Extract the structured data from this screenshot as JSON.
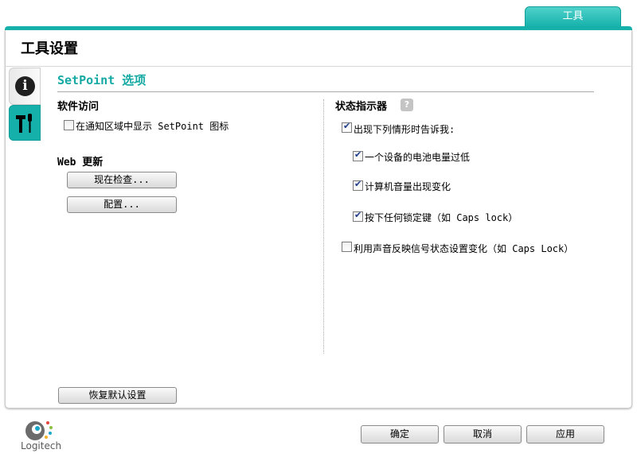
{
  "top_tab": {
    "label": "工具"
  },
  "panel": {
    "title": "工具设置"
  },
  "section": {
    "title": "SetPoint 选项"
  },
  "software_access": {
    "heading": "软件访问",
    "show_icon": {
      "label": "在通知区域中显示 SetPoint 图标",
      "checked": false
    }
  },
  "web_update": {
    "heading": "Web 更新",
    "check_now_label": "现在检查...",
    "configure_label": "配置..."
  },
  "status_indicator": {
    "heading": "状态指示器",
    "help_label": "?",
    "notify_me": {
      "label": "出现下列情形时告诉我:",
      "checked": true
    },
    "battery_low": {
      "label": "一个设备的电池电量过低",
      "checked": true
    },
    "volume_change": {
      "label": "计算机音量出现变化",
      "checked": true
    },
    "lock_key": {
      "label": "按下任何锁定键（如 Caps lock）",
      "checked": true
    },
    "sound_feedback": {
      "label": "利用声音反映信号状态设置变化（如 Caps Lock）",
      "checked": false
    }
  },
  "restore_defaults_label": "恢复默认设置",
  "footer": {
    "ok_label": "确定",
    "cancel_label": "取消",
    "apply_label": "应用",
    "logo_text": "Logitech"
  },
  "colors": {
    "accent": "#15b0aa",
    "heading": "#14a9a3"
  }
}
